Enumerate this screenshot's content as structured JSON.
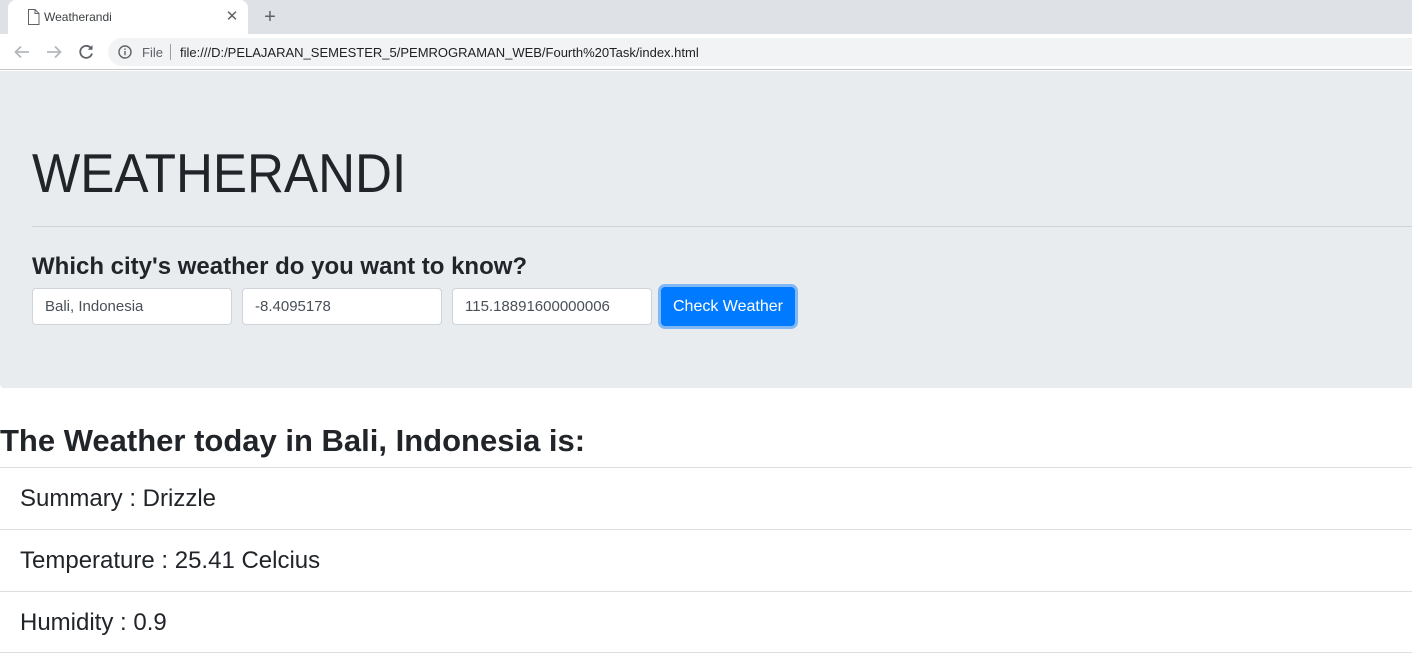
{
  "browser": {
    "tab_title": "Weatherandi",
    "tab_close": "✕",
    "new_tab": "+",
    "scheme_label": "File",
    "url": "file:///D:/PELAJARAN_SEMESTER_5/PEMROGRAMAN_WEB/Fourth%20Task/index.html"
  },
  "header": {
    "brand": "WEATHERANDI",
    "question": "Which city's weather do you want to know?"
  },
  "form": {
    "city_value": "Bali, Indonesia",
    "lat_value": "-8.4095178",
    "lng_value": "115.18891600000006",
    "button_label": "Check Weather"
  },
  "result": {
    "title": "The Weather today in Bali, Indonesia is:",
    "items": [
      {
        "label": "Summary : Drizzle"
      },
      {
        "label": "Temperature : 25.41 Celcius"
      },
      {
        "label": "Humidity : 0.9"
      }
    ]
  },
  "colors": {
    "accent": "#007bff",
    "jumbotron_bg": "#e9ecef",
    "tabstrip_bg": "#dee1e6"
  },
  "icons": [
    "document-icon",
    "close-icon",
    "plus-icon",
    "back-arrow-icon",
    "forward-arrow-icon",
    "reload-icon",
    "info-icon"
  ]
}
